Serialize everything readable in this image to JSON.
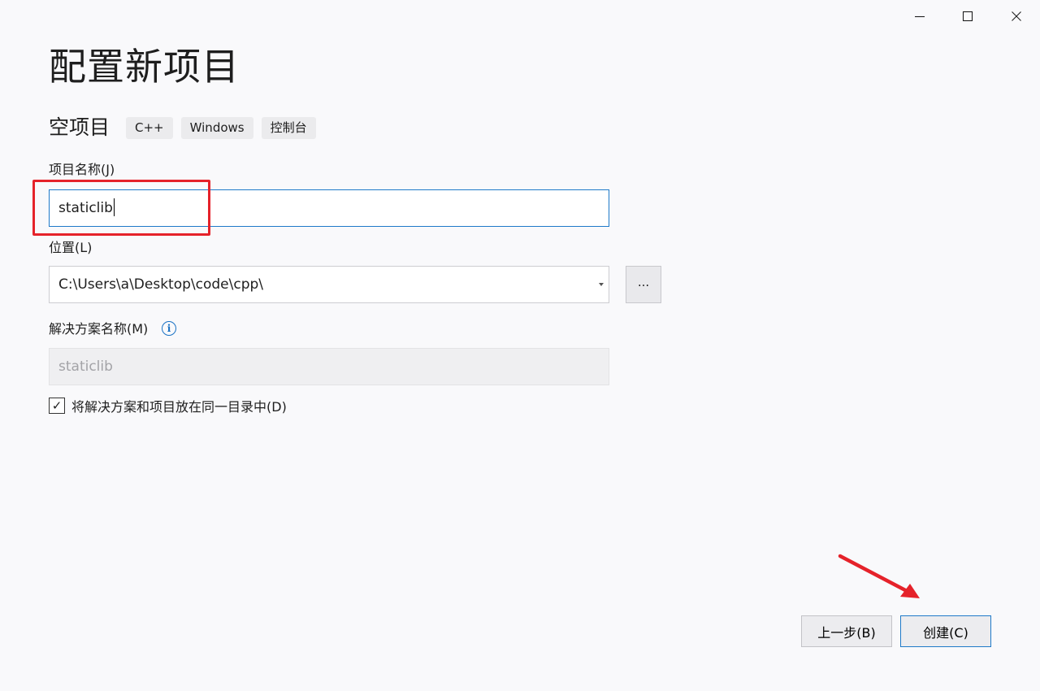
{
  "window_controls": {
    "minimize": "minimize-icon",
    "maximize": "maximize-icon",
    "close": "close-icon"
  },
  "title": "配置新项目",
  "template": {
    "name": "空项目",
    "tags": [
      "C++",
      "Windows",
      "控制台"
    ]
  },
  "project_name": {
    "label": "项目名称(J)",
    "value": "staticlib"
  },
  "location": {
    "label": "位置(L)",
    "value": "C:\\Users\\a\\Desktop\\code\\cpp\\",
    "browse_label": "..."
  },
  "solution_name": {
    "label": "解决方案名称(M)",
    "value": "staticlib",
    "info_icon": "i"
  },
  "same_directory": {
    "label": "将解决方案和项目放在同一目录中(D)",
    "checked": true,
    "check_glyph": "✓"
  },
  "buttons": {
    "back": "上一步(B)",
    "create": "创建(C)"
  },
  "colors": {
    "focus_border": "#1f7ac9",
    "annotation_red": "#e5222a",
    "info_blue": "#1a72c4"
  }
}
